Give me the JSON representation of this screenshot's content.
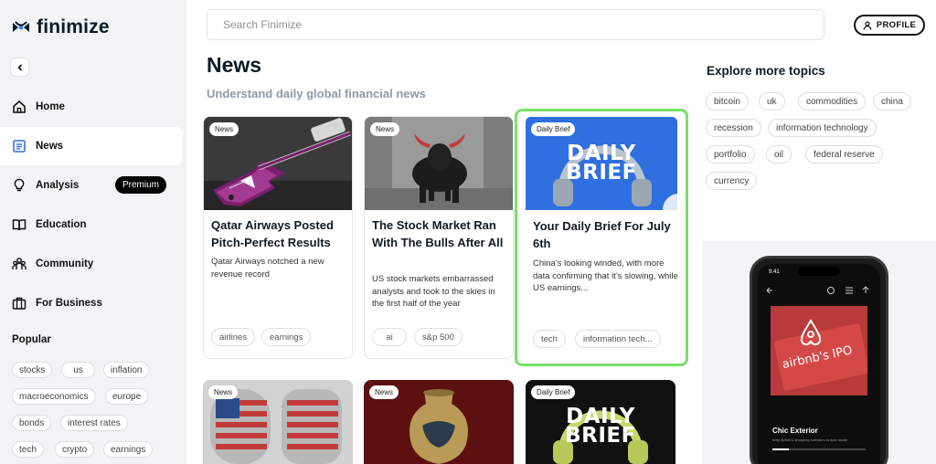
{
  "app": {
    "name": "finimize"
  },
  "search": {
    "placeholder": "Search Finimize"
  },
  "profile": {
    "label": "PROFILE"
  },
  "sidebar": {
    "items": [
      {
        "label": "Home",
        "icon": "home-icon"
      },
      {
        "label": "News",
        "icon": "news-icon",
        "active": true
      },
      {
        "label": "Analysis",
        "icon": "lightbulb-icon",
        "badge": "Premium"
      },
      {
        "label": "Education",
        "icon": "book-icon"
      },
      {
        "label": "Community",
        "icon": "people-icon"
      },
      {
        "label": "For Business",
        "icon": "briefcase-icon"
      }
    ],
    "popular_title": "Popular",
    "popular": [
      "stocks",
      "us",
      "inflation",
      "macroeconomics",
      "europe",
      "bonds",
      "interest rates",
      "tech",
      "crypto",
      "earnings"
    ]
  },
  "main": {
    "title": "News",
    "subtitle": "Understand daily global financial news",
    "cards": [
      {
        "badge": "News",
        "title": "Qatar Airways Posted Pitch-Perfect Results",
        "desc": "Qatar Airways notched a new revenue record",
        "tags": [
          "airlines",
          "earnings"
        ]
      },
      {
        "badge": "News",
        "title": "The Stock Market Ran With The Bulls After All",
        "desc": "US stock markets embarrassed analysts and took to the skies in the first half of the year",
        "tags": [
          "ai",
          "s&p 500"
        ]
      },
      {
        "badge": "Daily Brief",
        "image_text": [
          "DAILY",
          "BRIEF"
        ],
        "title": "Your Daily Brief For July 6th",
        "desc": "China’s looking winded, with more data confirming that it’s slowing, while US earnings...",
        "tags": [
          "tech",
          "information tech..."
        ]
      }
    ],
    "cards_row2": [
      {
        "badge": "News"
      },
      {
        "badge": "News"
      },
      {
        "badge": "Daily Brief",
        "image_text": [
          "DAILY",
          "BRIEF"
        ]
      }
    ]
  },
  "explore": {
    "title": "Explore more topics",
    "topics": [
      "bitcoin",
      "uk",
      "commodities",
      "china",
      "recession",
      "information technology",
      "portfolio",
      "oil",
      "federal reserve",
      "currency"
    ]
  },
  "promo": {
    "phone_time": "9:41",
    "image_text": "airbnb's IPO",
    "caption_title": "Chic Exterior",
    "caption_sub": "Why Airbnb's shopping investors in their inside"
  },
  "colors": {
    "highlight": "#78e06a",
    "daily_brief_blue": "#2f6fe0",
    "bull_red": "#c23b3b"
  }
}
